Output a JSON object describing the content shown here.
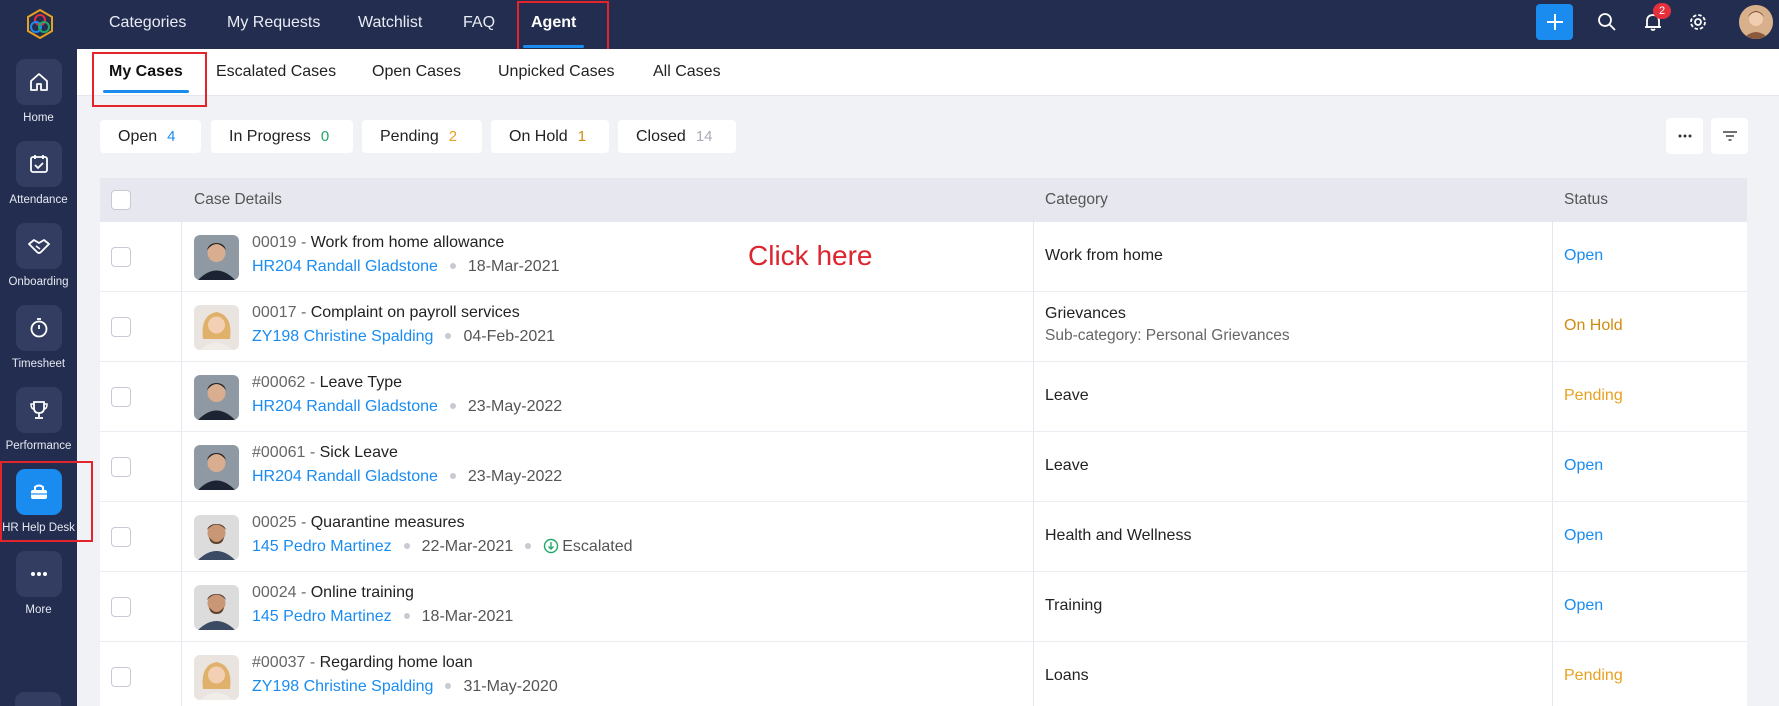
{
  "sidebar": {
    "items": [
      {
        "label": "Home",
        "icon": "home-icon"
      },
      {
        "label": "Attendance",
        "icon": "calendar-check-icon"
      },
      {
        "label": "Onboarding",
        "icon": "handshake-icon"
      },
      {
        "label": "Timesheet",
        "icon": "stopwatch-icon"
      },
      {
        "label": "Performance",
        "icon": "trophy-icon"
      },
      {
        "label": "HR Help Desk",
        "icon": "helpdesk-icon"
      },
      {
        "label": "More",
        "icon": "more-icon"
      }
    ]
  },
  "topnav": {
    "items": [
      "Categories",
      "My Requests",
      "Watchlist",
      "FAQ",
      "Agent"
    ],
    "notification_count": "2"
  },
  "subtabs": [
    "My Cases",
    "Escalated Cases",
    "Open Cases",
    "Unpicked Cases",
    "All Cases"
  ],
  "filters": [
    {
      "label": "Open",
      "count": "4",
      "color": "#1a8cf0"
    },
    {
      "label": "In Progress",
      "count": "0",
      "color": "#22a86b"
    },
    {
      "label": "Pending",
      "count": "2",
      "color": "#e8a020"
    },
    {
      "label": "On Hold",
      "count": "1",
      "color": "#d08c10"
    },
    {
      "label": "Closed",
      "count": "14",
      "color": "#a9acb6"
    }
  ],
  "table": {
    "headers": {
      "case_details": "Case Details",
      "category": "Category",
      "status": "Status"
    },
    "rows": [
      {
        "id": "00019",
        "title": "Work from home allowance",
        "employee": "HR204 Randall Gladstone",
        "date": "18-Mar-2021",
        "category": "Work from home",
        "subcategory": "",
        "escalated": "",
        "status": "Open",
        "status_color": "#1a8cf0"
      },
      {
        "id": "00017",
        "title": "Complaint on payroll services",
        "employee": "ZY198 Christine Spalding",
        "date": "04-Feb-2021",
        "category": "Grievances",
        "subcategory": "Sub-category: Personal Grievances",
        "escalated": "",
        "status": "On Hold",
        "status_color": "#d08c10"
      },
      {
        "id": "#00062",
        "title": "Leave Type",
        "employee": "HR204 Randall Gladstone",
        "date": "23-May-2022",
        "category": "Leave",
        "subcategory": "",
        "escalated": "",
        "status": "Pending",
        "status_color": "#e8a020"
      },
      {
        "id": "#00061",
        "title": "Sick Leave",
        "employee": "HR204 Randall Gladstone",
        "date": "23-May-2022",
        "category": "Leave",
        "subcategory": "",
        "escalated": "",
        "status": "Open",
        "status_color": "#1a8cf0"
      },
      {
        "id": "00025",
        "title": "Quarantine measures",
        "employee": "145 Pedro Martinez",
        "date": "22-Mar-2021",
        "category": "Health and Wellness",
        "subcategory": "",
        "escalated": "Escalated",
        "status": "Open",
        "status_color": "#1a8cf0"
      },
      {
        "id": "00024",
        "title": "Online training",
        "employee": "145 Pedro Martinez",
        "date": "18-Mar-2021",
        "category": "Training",
        "subcategory": "",
        "escalated": "",
        "status": "Open",
        "status_color": "#1a8cf0"
      },
      {
        "id": "#00037",
        "title": "Regarding home loan",
        "employee": "ZY198 Christine Spalding",
        "date": "31-May-2020",
        "category": "Loans",
        "subcategory": "",
        "escalated": "",
        "status": "Pending",
        "status_color": "#e8a020"
      }
    ]
  },
  "annotation": "Click here",
  "colors": {
    "sidebar_bg": "#232d4f",
    "accent": "#1a8cf0",
    "highlight": "#e3242b"
  }
}
